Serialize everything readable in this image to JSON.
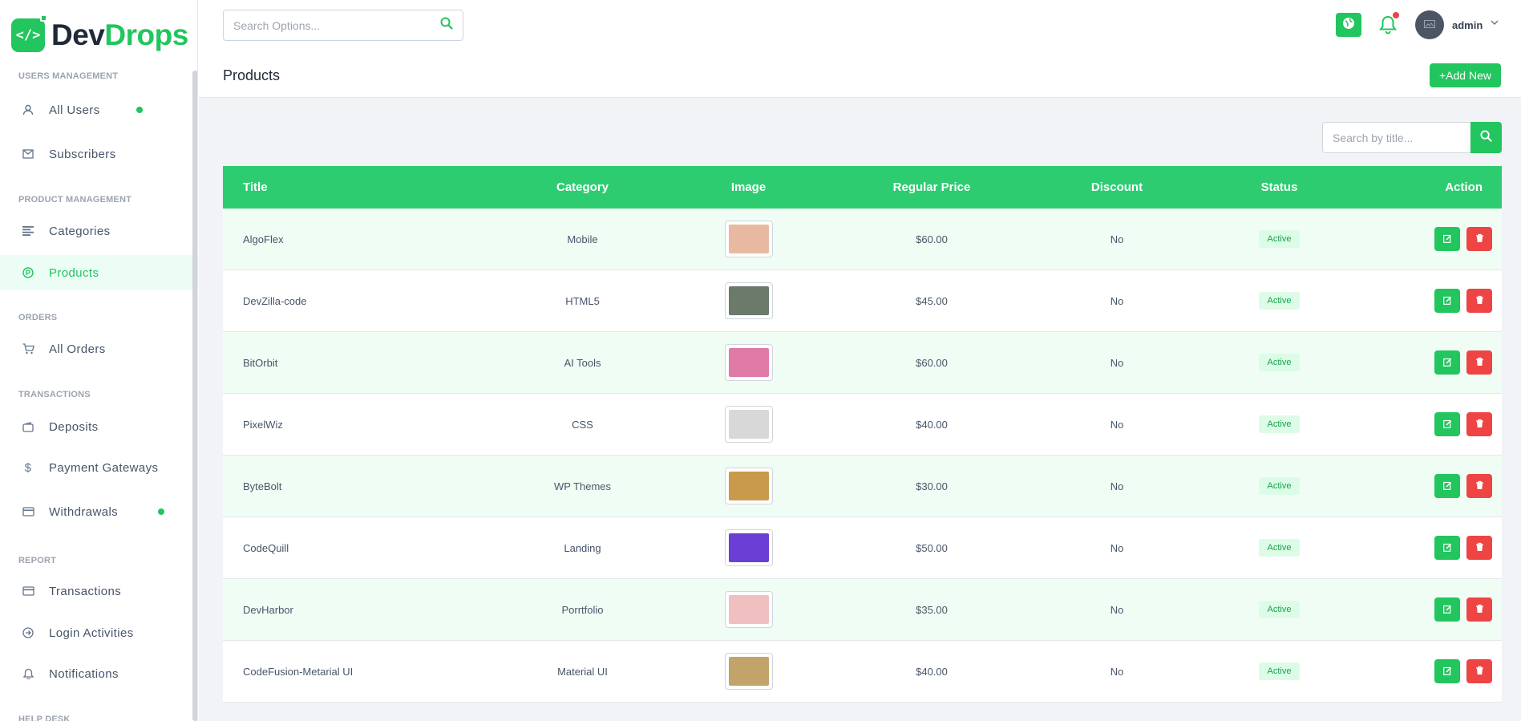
{
  "brand": {
    "dev": "Dev",
    "drops": "Drops",
    "mark": "</>"
  },
  "sidebar": {
    "sections": [
      {
        "title": "USERS MANAGEMENT"
      },
      {
        "title": "PRODUCT MANAGEMENT"
      },
      {
        "title": "ORDERS"
      },
      {
        "title": "TRANSACTIONS"
      },
      {
        "title": "REPORT"
      },
      {
        "title": "HELP DESK"
      }
    ],
    "items": [
      {
        "label": "All Users",
        "icon": "user-icon"
      },
      {
        "label": "Subscribers",
        "icon": "mail-icon"
      },
      {
        "label": "Categories",
        "icon": "list-icon"
      },
      {
        "label": "Products",
        "icon": "product-icon"
      },
      {
        "label": "All Orders",
        "icon": "cart-icon"
      },
      {
        "label": "Deposits",
        "icon": "wallet-icon"
      },
      {
        "label": "Payment Gateways",
        "icon": "dollar-icon"
      },
      {
        "label": "Withdrawals",
        "icon": "card-icon"
      },
      {
        "label": "Transactions",
        "icon": "card-icon"
      },
      {
        "label": "Login Activities",
        "icon": "login-icon"
      },
      {
        "label": "Notifications",
        "icon": "bell-icon"
      }
    ]
  },
  "header": {
    "search_placeholder": "Search Options...",
    "admin_name": "admin"
  },
  "page": {
    "title": "Products",
    "add_label": "+Add New",
    "title_search_placeholder": "Search by title..."
  },
  "table": {
    "columns": [
      "Title",
      "Category",
      "Image",
      "Regular Price",
      "Discount",
      "Status",
      "Action"
    ],
    "rows": [
      {
        "title": "AlgoFlex",
        "category": "Mobile",
        "price": "$60.00",
        "discount": "No",
        "status": "Active"
      },
      {
        "title": "DevZilla-code",
        "category": "HTML5",
        "price": "$45.00",
        "discount": "No",
        "status": "Active"
      },
      {
        "title": "BitOrbit",
        "category": "AI Tools",
        "price": "$60.00",
        "discount": "No",
        "status": "Active"
      },
      {
        "title": "PixelWiz",
        "category": "CSS",
        "price": "$40.00",
        "discount": "No",
        "status": "Active"
      },
      {
        "title": "ByteBolt",
        "category": "WP Themes",
        "price": "$30.00",
        "discount": "No",
        "status": "Active"
      },
      {
        "title": "CodeQuill",
        "category": "Landing",
        "price": "$50.00",
        "discount": "No",
        "status": "Active"
      },
      {
        "title": "DevHarbor",
        "category": "Porrtfolio",
        "price": "$35.00",
        "discount": "No",
        "status": "Active"
      },
      {
        "title": "CodeFusion-Metarial UI",
        "category": "Material UI",
        "price": "$40.00",
        "discount": "No",
        "status": "Active"
      }
    ]
  },
  "colors": {
    "accent": "#22c55e",
    "danger": "#ef4444",
    "thumbs": [
      "#e8b9a0",
      "#6b7a6b",
      "#e07aa6",
      "#d8d8d8",
      "#c89a4a",
      "#6b3fd6",
      "#f0c0c0",
      "#c2a36a",
      "#7a3a3a"
    ]
  }
}
